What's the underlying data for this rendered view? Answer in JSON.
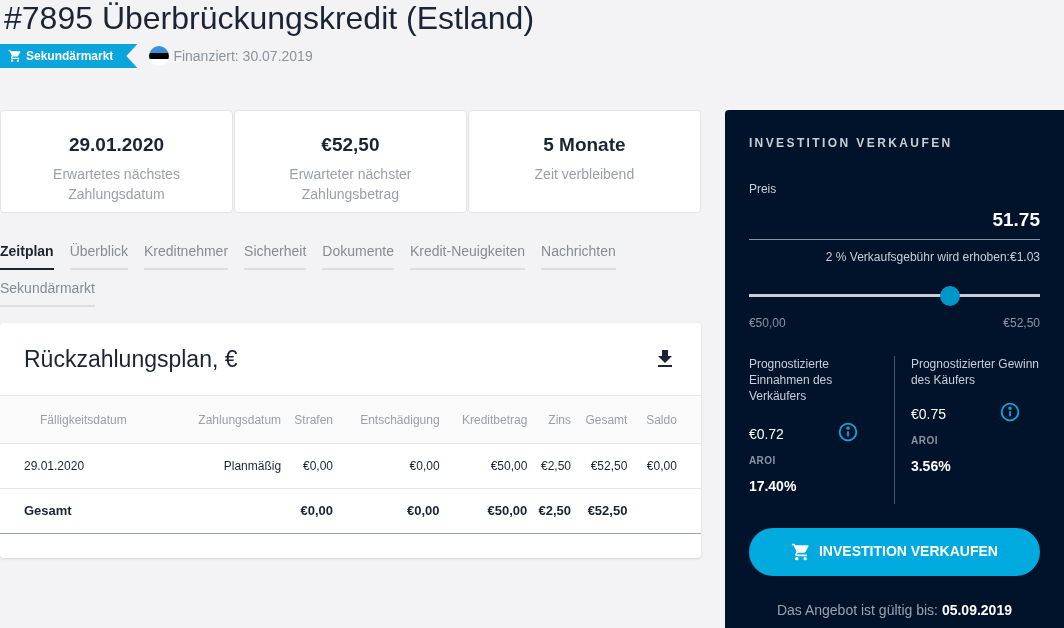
{
  "title": "#7895 Überbrückungskredit (Estland)",
  "badge": {
    "label": "Sekundärmarkt"
  },
  "funded": "Finanziert: 30.07.2019",
  "stats": [
    {
      "value": "29.01.2020",
      "label": "Erwartetes nächstes Zahlungsdatum"
    },
    {
      "value": "€52,50",
      "label": "Erwarteter nächster Zahlungsbetrag"
    },
    {
      "value": "5 Monate",
      "label": "Zeit verbleibend"
    }
  ],
  "tabs": [
    {
      "label": "Zeitplan",
      "selected": true
    },
    {
      "label": "Überblick",
      "selected": false
    },
    {
      "label": "Kreditnehmer",
      "selected": false
    },
    {
      "label": "Sicherheit",
      "selected": false
    },
    {
      "label": "Dokumente",
      "selected": false
    },
    {
      "label": "Kredit-Neuigkeiten",
      "selected": false
    },
    {
      "label": "Nachrichten",
      "selected": false
    },
    {
      "label": "Sekundärmarkt",
      "selected": false
    }
  ],
  "schedule": {
    "title": "Rückzahlungsplan, €",
    "columns": [
      "Fälligkeitsdatum",
      "Zahlungsdatum",
      "Strafen",
      "Entschädigung",
      "Kreditbetrag",
      "Zins",
      "Gesamt",
      "Saldo"
    ],
    "rows": [
      [
        "29.01.2020",
        "Planmäßig",
        "€0,00",
        "€0,00",
        "€50,00",
        "€2,50",
        "€52,50",
        "€0,00"
      ]
    ],
    "total": {
      "label": "Gesamt",
      "strafen": "€0,00",
      "entschaedigung": "€0,00",
      "kreditbetrag": "€50,00",
      "zins": "€2,50",
      "gesamt": "€52,50"
    }
  },
  "sell": {
    "title": "INVESTITION VERKAUFEN",
    "price_label": "Preis",
    "price": "51.75",
    "fee": "2 % Verkaufsgebühr wird erhoben:€1.03",
    "slider": {
      "level": 0.69,
      "min": "€50,00",
      "max": "€52,50"
    },
    "seller": {
      "label": "Prognostizierte Einnahmen des Verkäufers",
      "amount": "€0.72",
      "aroi_label": "AROI",
      "aroi": "17.40%"
    },
    "buyer": {
      "label": "Prognostizierter Gewinn des Käufers",
      "amount": "€0.75",
      "aroi_label": "AROI",
      "aroi": "3.56%"
    },
    "button": "INVESTITION VERKAUFEN",
    "valid": "Das Angebot ist gültig bis: **05.09.2019**"
  }
}
